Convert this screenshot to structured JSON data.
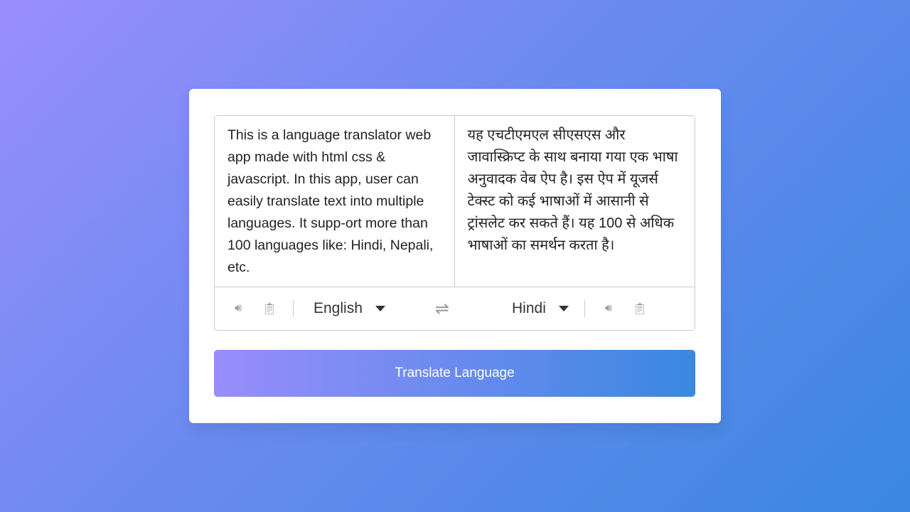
{
  "from_text": "This is a language translator web app made with html css & javascript. In this app, user can easily translate text into multiple languages. It supp-ort more than 100 languages like: Hindi, Nepali, etc.",
  "to_text": "यह एचटीएमएल सीएसएस और जावास्क्रिप्ट के साथ बनाया गया एक भाषा अनुवादक वेब ऐप है। इस ऐप में यूजर्स टेक्स्ट को कई भाषाओं में आसानी से ट्रांसलेट कर सकते हैं। यह 100 से अधिक भाषाओं का समर्थन करता है।",
  "from_language": "English",
  "to_language": "Hindi",
  "icons": {
    "speak": "volume-icon",
    "copy": "copy-icon",
    "swap": "exchange-icon"
  },
  "button_label": "Translate Language",
  "colors": {
    "gradient_start": "#998dfd",
    "gradient_end": "#3a88e0"
  }
}
